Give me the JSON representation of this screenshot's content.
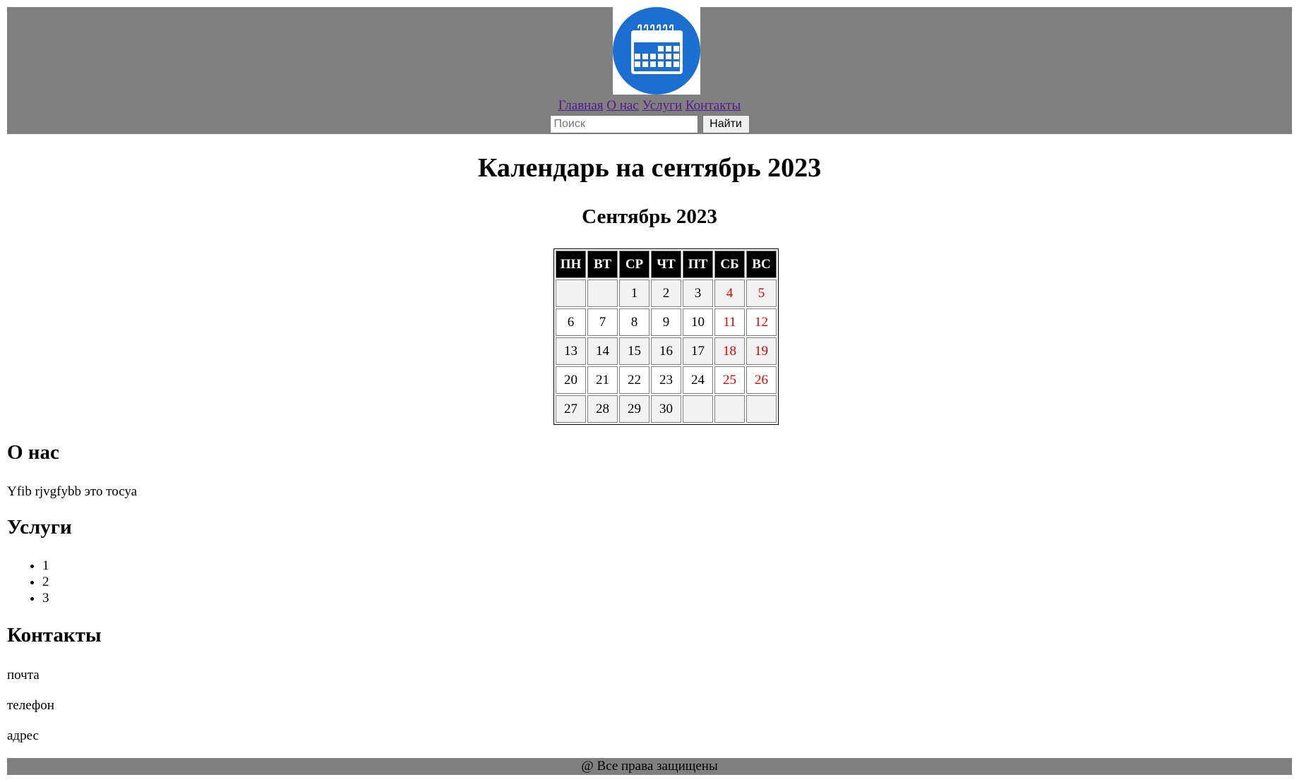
{
  "header": {
    "logo_icon": "calendar-icon",
    "logo_color": "#1a6fd0",
    "nav": [
      "Главная",
      "О нас",
      "Услуги",
      "Контакты"
    ],
    "search": {
      "placeholder": "Поиск",
      "value": "",
      "button_label": "Найти"
    }
  },
  "main": {
    "title": "Календарь на сентябрь 2023",
    "month_title": "Сентябрь 2023",
    "calendar": {
      "weekdays": [
        "ПН",
        "ВТ",
        "СР",
        "ЧТ",
        "ПТ",
        "СБ",
        "ВС"
      ],
      "weeks": [
        [
          "",
          "",
          "1",
          "2",
          "3",
          "4",
          "5"
        ],
        [
          "6",
          "7",
          "8",
          "9",
          "10",
          "11",
          "12"
        ],
        [
          "13",
          "14",
          "15",
          "16",
          "17",
          "18",
          "19"
        ],
        [
          "20",
          "21",
          "22",
          "23",
          "24",
          "25",
          "26"
        ],
        [
          "27",
          "28",
          "29",
          "30",
          "",
          "",
          ""
        ]
      ],
      "weekend_color": "#e00000"
    }
  },
  "about": {
    "heading": "О нас",
    "text": "Yfib rjvgfybb это тосуа"
  },
  "services": {
    "heading": "Услуги",
    "items": [
      "1",
      "2",
      "3"
    ]
  },
  "contacts": {
    "heading": "Контакты",
    "items": [
      "почта",
      "телефон",
      "адрес"
    ]
  },
  "footer": {
    "text": "@ Все права защищены"
  }
}
